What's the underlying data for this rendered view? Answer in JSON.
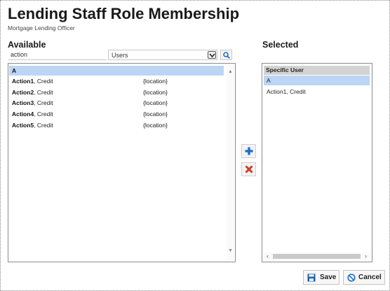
{
  "page": {
    "title": "Lending Staff Role Membership",
    "subtitle": "Mortgage Lending Officer"
  },
  "available": {
    "label": "Available",
    "search_value": "action",
    "type_selected": "Users",
    "rows": [
      {
        "name_bold": "A",
        "name_rest": "",
        "location": ""
      },
      {
        "name_bold": "Action1",
        "name_rest": ", Credit",
        "location": "{location}"
      },
      {
        "name_bold": "Action2",
        "name_rest": ", Credit",
        "location": "{location}"
      },
      {
        "name_bold": "Action3",
        "name_rest": ", Credit",
        "location": "{location}"
      },
      {
        "name_bold": "Action4",
        "name_rest": ", Credit",
        "location": "{location}"
      },
      {
        "name_bold": "Action5",
        "name_rest": ", Credit",
        "location": "{location}"
      }
    ]
  },
  "selected": {
    "label": "Selected",
    "header": "Specific User",
    "rows": [
      "A",
      "Action1, Credit"
    ]
  },
  "footer": {
    "save_label": "Save",
    "cancel_label": "Cancel"
  },
  "colors": {
    "highlight": "#bdd5f5",
    "add_icon": "#1f6fc8",
    "remove_icon": "#d23a2a",
    "save_icon": "#1f5fa8"
  }
}
